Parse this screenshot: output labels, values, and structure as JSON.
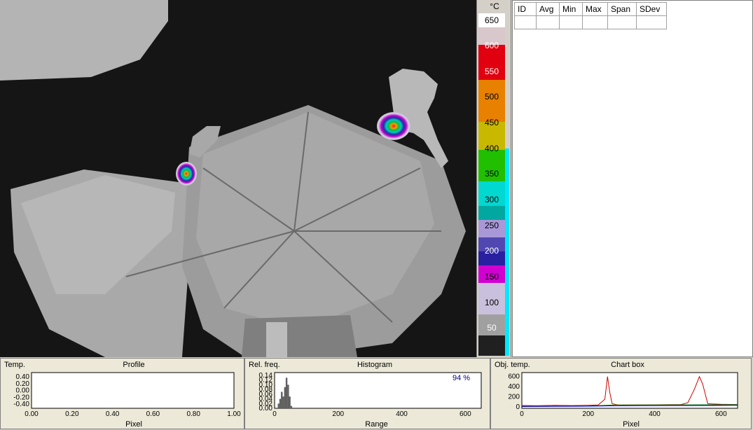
{
  "colors": {
    "scale_gradient": [
      "#1b1b1b",
      "#5a5a5a",
      "#9a9a9a",
      "#cfc7d6",
      "#b9a7dc",
      "#d400cf",
      "#7a00c8",
      "#21208f",
      "#6d5fb5",
      "#b09ee0",
      "#00a29a",
      "#00d8d2",
      "#00c8b8",
      "#00c000",
      "#60d000",
      "#c8c800",
      "#e8a000",
      "#e86000",
      "#f00000",
      "#c00040",
      "#d0d0d0",
      "#ffffff"
    ],
    "profile_line": "#000000",
    "chart_red": "#d00000",
    "chart_green": "#008000",
    "chart_blue": "#0000c0",
    "histogram_bars": "#606060",
    "percent_text": "#000080"
  },
  "scale": {
    "unit": "°C",
    "ticks": [
      "650",
      "600",
      "550",
      "500",
      "450",
      "400",
      "350",
      "300",
      "250",
      "200",
      "150",
      "100",
      "50"
    ]
  },
  "stats_table": {
    "headers": [
      "ID",
      "Avg",
      "Min",
      "Max",
      "Span",
      "SDev"
    ]
  },
  "profile_panel": {
    "ylabel": "Temp.",
    "title": "Profile",
    "xlabel": "Pixel",
    "yticks": [
      "0.40",
      "0.20",
      "0.00",
      "-0.20",
      "-0.40"
    ],
    "xticks": [
      "0.00",
      "0.20",
      "0.40",
      "0.60",
      "0.80",
      "1.00"
    ]
  },
  "histogram_panel": {
    "ylabel": "Rel. freq.",
    "title": "Histogram",
    "xlabel": "Range",
    "percent": "94 %",
    "yticks": [
      "0.14",
      "0.12",
      "0.10",
      "0.08",
      "0.06",
      "0.04",
      "0.02",
      "0.00"
    ],
    "xticks": [
      "0",
      "200",
      "400",
      "600"
    ]
  },
  "chart_panel": {
    "ylabel": "Obj. temp.",
    "title": "Chart box",
    "xlabel": "Pixel",
    "yticks": [
      "600",
      "400",
      "200",
      "0"
    ],
    "xticks": [
      "0",
      "200",
      "400",
      "600"
    ]
  },
  "chart_data": [
    {
      "type": "line",
      "title": "Chart box",
      "xlabel": "Pixel",
      "ylabel": "Obj. temp.",
      "xlim": [
        0,
        650
      ],
      "ylim": [
        -30,
        680
      ],
      "series": [
        {
          "color": "#d00000",
          "x": [
            0,
            50,
            100,
            150,
            200,
            230,
            250,
            258,
            265,
            272,
            290,
            350,
            400,
            450,
            480,
            500,
            520,
            535,
            545,
            560,
            600,
            650
          ],
          "y": [
            25,
            22,
            28,
            24,
            30,
            35,
            150,
            600,
            280,
            60,
            35,
            38,
            40,
            42,
            45,
            80,
            350,
            600,
            450,
            60,
            50,
            45
          ]
        },
        {
          "color": "#008000",
          "x": [
            0,
            100,
            200,
            280,
            350,
            450,
            550,
            650
          ],
          "y": [
            10,
            12,
            15,
            35,
            35,
            38,
            40,
            42
          ]
        },
        {
          "color": "#0000c0",
          "x": [
            0,
            100,
            200,
            280,
            350,
            450,
            550,
            650
          ],
          "y": [
            5,
            8,
            12,
            20,
            22,
            24,
            26,
            28
          ]
        }
      ]
    },
    {
      "type": "bar",
      "title": "Histogram",
      "xlabel": "Range",
      "ylabel": "Rel. freq.",
      "xlim": [
        0,
        650
      ],
      "ylim": [
        0,
        0.14
      ],
      "x": [
        10,
        15,
        20,
        25,
        30,
        35,
        40,
        45,
        50
      ],
      "values": [
        0.02,
        0.04,
        0.07,
        0.05,
        0.09,
        0.13,
        0.1,
        0.05,
        0.01
      ]
    },
    {
      "type": "line",
      "title": "Profile",
      "xlabel": "Pixel",
      "ylabel": "Temp.",
      "xlim": [
        0,
        1
      ],
      "ylim": [
        -0.5,
        0.5
      ],
      "series": []
    }
  ]
}
